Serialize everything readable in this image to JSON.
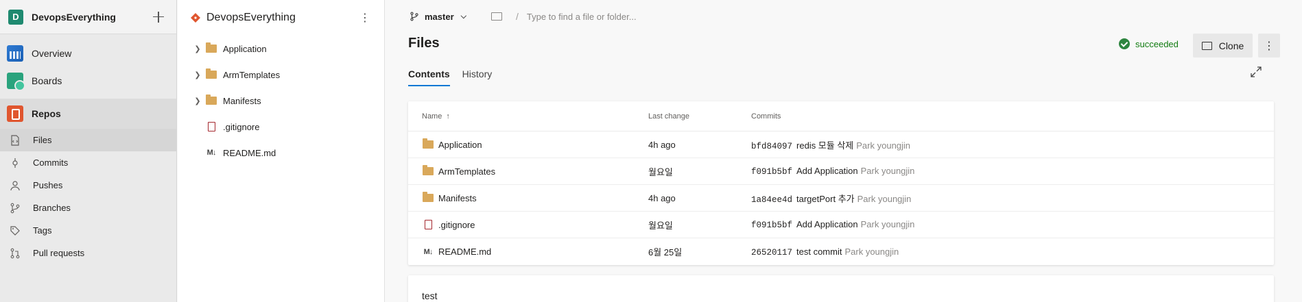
{
  "org": {
    "avatar_letter": "D",
    "name": "DevopsEverything"
  },
  "nav": {
    "items": [
      {
        "label": "Overview",
        "icon": "overview-icon"
      },
      {
        "label": "Boards",
        "icon": "boards-icon"
      },
      {
        "label": "Repos",
        "icon": "repos-icon"
      }
    ],
    "sub_items": [
      {
        "label": "Files",
        "icon": "files-icon"
      },
      {
        "label": "Commits",
        "icon": "commits-icon"
      },
      {
        "label": "Pushes",
        "icon": "pushes-icon"
      },
      {
        "label": "Branches",
        "icon": "branches-icon"
      },
      {
        "label": "Tags",
        "icon": "tags-icon"
      },
      {
        "label": "Pull requests",
        "icon": "pull-requests-icon"
      }
    ]
  },
  "tree": {
    "repo_name": "DevopsEverything",
    "items": [
      {
        "label": "Application",
        "type": "folder"
      },
      {
        "label": "ArmTemplates",
        "type": "folder"
      },
      {
        "label": "Manifests",
        "type": "folder"
      },
      {
        "label": ".gitignore",
        "type": "file"
      },
      {
        "label": "README.md",
        "type": "markdown"
      }
    ]
  },
  "main": {
    "branch": "master",
    "path_placeholder": "Type to find a file or folder...",
    "path_slash": "/",
    "title": "Files",
    "status": "succeeded",
    "clone_label": "Clone",
    "tabs": [
      "Contents",
      "History"
    ],
    "table": {
      "headers": {
        "name": "Name",
        "last_change": "Last change",
        "commits": "Commits"
      },
      "sort_arrow": "↑",
      "rows": [
        {
          "name": "Application",
          "type": "folder",
          "last_change": "4h ago",
          "hash": "bfd84097",
          "message": "redis 모듈 삭제",
          "author": "Park youngjin"
        },
        {
          "name": "ArmTemplates",
          "type": "folder",
          "last_change": "월요일",
          "hash": "f091b5bf",
          "message": "Add Application",
          "author": "Park youngjin"
        },
        {
          "name": "Manifests",
          "type": "folder",
          "last_change": "4h ago",
          "hash": "1a84ee4d",
          "message": "targetPort 추가",
          "author": "Park youngjin"
        },
        {
          "name": ".gitignore",
          "type": "file",
          "last_change": "월요일",
          "hash": "f091b5bf",
          "message": "Add Application",
          "author": "Park youngjin"
        },
        {
          "name": "README.md",
          "type": "markdown",
          "last_change": "6월 25일",
          "hash": "26520117",
          "message": "test commit",
          "author": "Park youngjin"
        }
      ]
    },
    "readme_preview": "test"
  }
}
